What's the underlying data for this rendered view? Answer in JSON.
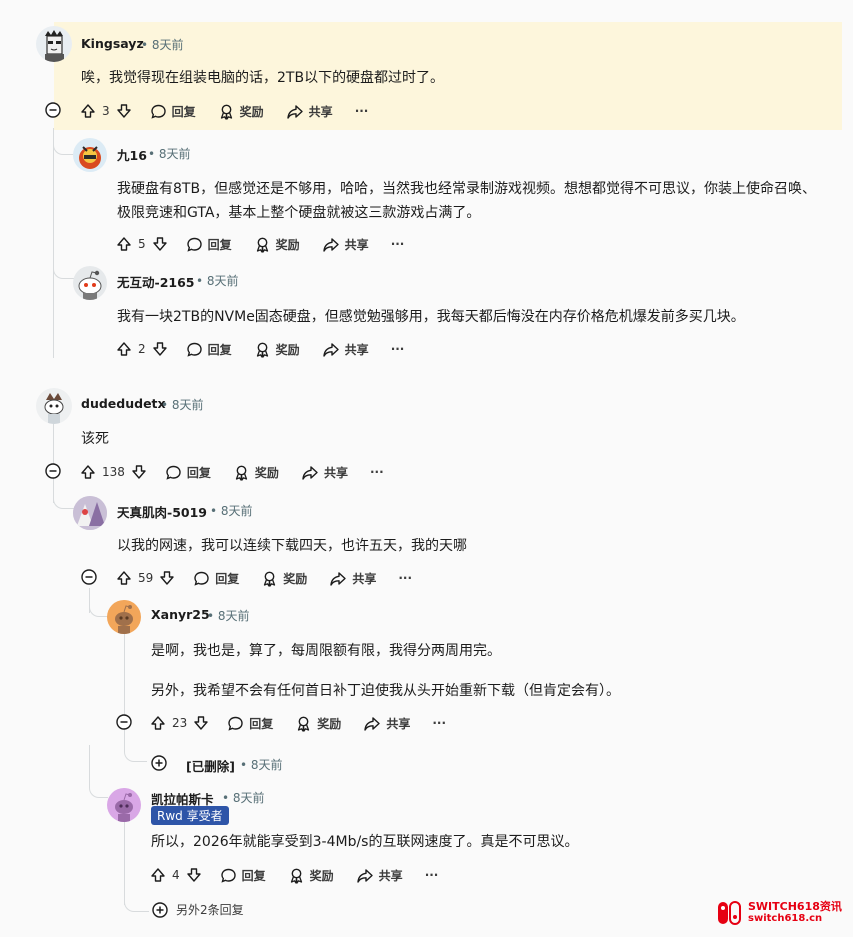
{
  "comments": [
    {
      "user": "Kingsayz",
      "time": "8天前",
      "text": "唉，我觉得现在组装电脑的话，2TB以下的硬盘都过时了。",
      "votes": "3"
    },
    {
      "user": "九16",
      "time": "8天前",
      "text": "我硬盘有8TB，但感觉还是不够用，哈哈，当然我也经常录制游戏视频。想想都觉得不可思议，你装上使命召唤、极限竞速和GTA，基本上整个硬盘就被这三款游戏占满了。",
      "votes": "5"
    },
    {
      "user": "无互动-2165",
      "time": "8天前",
      "text": "我有一块2TB的NVMe固态硬盘，但感觉勉强够用，我每天都后悔没在内存价格危机爆发前多买几块。",
      "votes": "2"
    },
    {
      "user": "dudedudetx",
      "time": "8天前",
      "text": "该死",
      "votes": "138"
    },
    {
      "user": "天真肌肉-5019",
      "time": "8天前",
      "text": "以我的网速，我可以连续下载四天，也许五天，我的天哪",
      "votes": "59"
    },
    {
      "user": "Xanyr25",
      "time": "8天前",
      "text": "是啊，我也是，算了，每周限额有限，我得分两周用完。",
      "text2": "另外，我希望不会有任何首日补丁迫使我从头开始重新下载（但肯定会有）。",
      "votes": "23"
    },
    {
      "user": "凯拉帕斯卡",
      "time": "8天前",
      "flair": "Rwd 享受者",
      "text": "所以，2026年就能享受到3-4Mb/s的互联网速度了。真是不可思议。",
      "votes": "4"
    }
  ],
  "deleted": {
    "label": "[已删除]",
    "time": "8天前"
  },
  "actions": {
    "reply": "回复",
    "award": "奖励",
    "share": "共享",
    "more": "···"
  },
  "dot": "•",
  "more_replies": "另外2条回复",
  "watermark": {
    "brand": "SWITCH618资讯",
    "site": "switch618.cn"
  }
}
